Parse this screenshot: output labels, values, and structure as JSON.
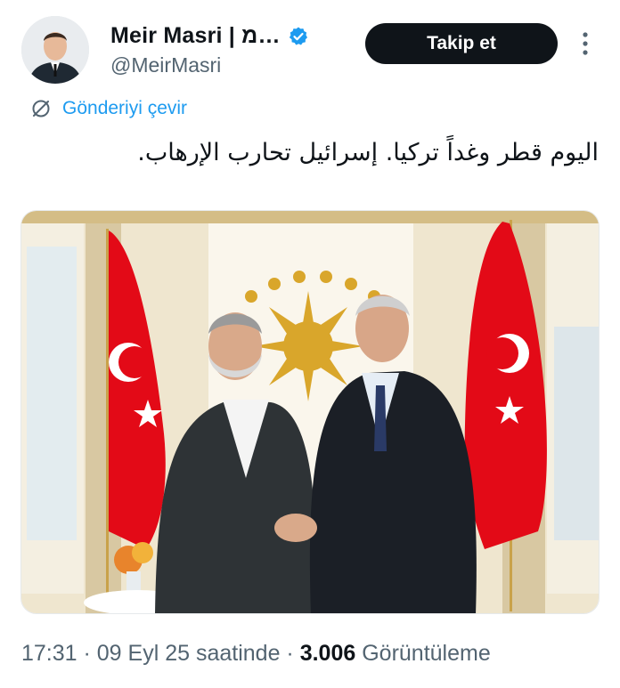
{
  "author": {
    "display_name": "Meir Masri | מ…",
    "handle": "@MeirMasri",
    "verified": true,
    "avatar_icon": "profile-photo"
  },
  "actions": {
    "follow_label": "Takip et",
    "more_icon": "more-vertical-icon"
  },
  "translate": {
    "label": "Gönderiyi çevir",
    "icon": "translate-globe-icon"
  },
  "tweet": {
    "text": "اليوم قطر وغداً تركيا. إسرائيل تحارب الإرهاب."
  },
  "media": {
    "type": "photo",
    "icon": "photo-two-men-handshake-flags"
  },
  "meta": {
    "time": "17:31",
    "sep1": " · ",
    "date": "09 Eyl 25 saatinde",
    "sep2": " · ",
    "views_count": "3.006",
    "views_label": "Görüntüleme"
  },
  "colors": {
    "accent": "#1d9bf0",
    "text": "#0f1419",
    "muted": "#536471",
    "button": "#0f1419",
    "flag_red": "#e30a17"
  }
}
